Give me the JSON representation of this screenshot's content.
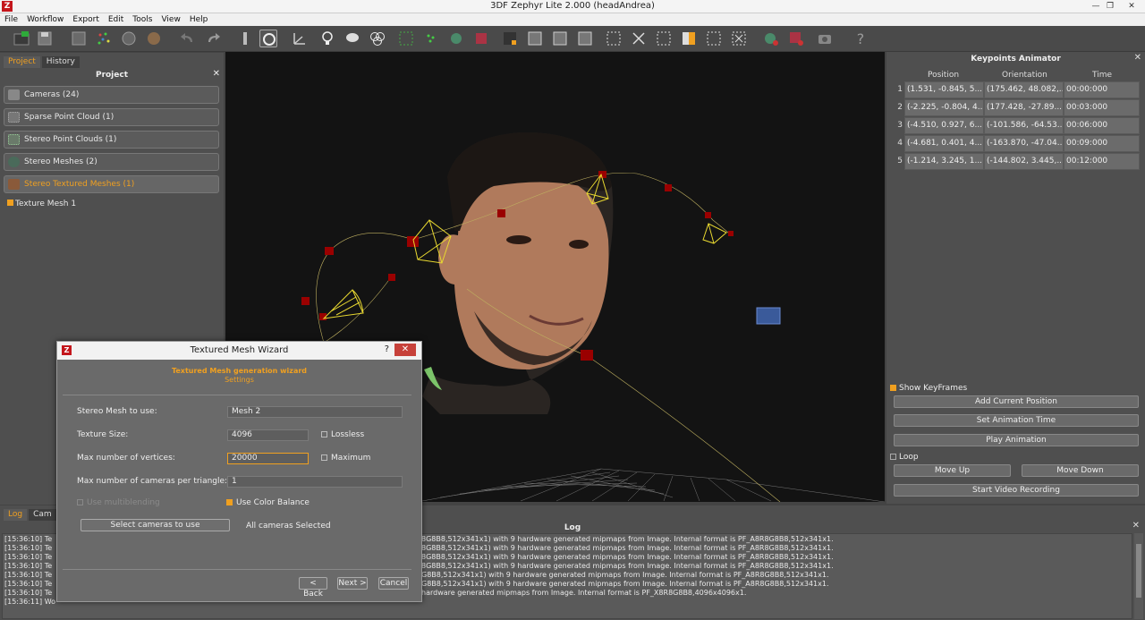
{
  "window": {
    "title": "3DF Zephyr Lite 2.000 (headAndrea)",
    "app_icon": "Z"
  },
  "menu": [
    "File",
    "Workflow",
    "Export",
    "Edit",
    "Tools",
    "View",
    "Help"
  ],
  "left_panel": {
    "tabs": [
      "Project",
      "History"
    ],
    "title": "Project",
    "items": [
      {
        "label": "Cameras (24)",
        "icon": "camera-icon"
      },
      {
        "label": "Sparse Point Cloud (1)",
        "icon": "sparse-cloud-icon"
      },
      {
        "label": "Stereo Point Clouds (1)",
        "icon": "dense-cloud-icon"
      },
      {
        "label": "Stereo Meshes (2)",
        "icon": "mesh-icon"
      },
      {
        "label": "Stereo Textured Meshes (1)",
        "icon": "textured-mesh-icon"
      }
    ],
    "subitem": "Texture Mesh 1"
  },
  "right_panel": {
    "title": "Keypoints Animator",
    "columns": [
      "Position",
      "Orientation",
      "Time"
    ],
    "rows": [
      {
        "n": "1",
        "position": "(1.531, -0.845, 5...",
        "orientation": "(175.462, 48.082,...",
        "time": "00:00:000"
      },
      {
        "n": "2",
        "position": "(-2.225, -0.804, 4...",
        "orientation": "(177.428, -27.89...",
        "time": "00:03:000"
      },
      {
        "n": "3",
        "position": "(-4.510, 0.927, 6...",
        "orientation": "(-101.586, -64.53...",
        "time": "00:06:000"
      },
      {
        "n": "4",
        "position": "(-4.681, 0.401, 4...",
        "orientation": "(-163.870, -47.04...",
        "time": "00:09:000"
      },
      {
        "n": "5",
        "position": "(-1.214, 3.245, 1...",
        "orientation": "(-144.802, 3.445,...",
        "time": "00:12:000"
      }
    ],
    "show_keyframes": "Show KeyFrames",
    "add_current_position": "Add Current Position",
    "set_animation_time": "Set Animation Time",
    "play_animation": "Play Animation",
    "loop": "Loop",
    "move_up": "Move Up",
    "move_down": "Move Down",
    "start_video_recording": "Start Video Recording"
  },
  "log": {
    "tabs": [
      "Log",
      "Cam"
    ],
    "title": "Log",
    "lines": [
      "[15:36:10] Te",
      "[15:36:10] Te",
      "[15:36:10] Te",
      "[15:36:10] Te",
      "[15:36:10] Te",
      "[15:36:10] Te",
      "[15:36:10] Te",
      "[15:36:11] Wo"
    ],
    "tails": [
      "8G8B8,512x341x1) with 9 hardware generated mipmaps from Image. Internal format is PF_A8R8G8B8,512x341x1.",
      "8G8B8,512x341x1) with 9 hardware generated mipmaps from Image. Internal format is PF_A8R8G8B8,512x341x1.",
      "8G8B8,512x341x1) with 9 hardware generated mipmaps from Image. Internal format is PF_A8R8G8B8,512x341x1.",
      "8G8B8,512x341x1) with 9 hardware generated mipmaps from Image. Internal format is PF_A8R8G8B8,512x341x1.",
      "G8B8,512x341x1) with 9 hardware generated mipmaps from Image. Internal format is PF_A8R8G8B8,512x341x1.",
      "G8B8,512x341x1) with 9 hardware generated mipmaps from Image. Internal format is PF_A8R8G8B8,512x341x1.",
      "hardware generated mipmaps from Image. Internal format is PF_X8R8G8B8,4096x4096x1."
    ]
  },
  "dialog": {
    "title": "Textured Mesh Wizard",
    "help": "?",
    "close": "✕",
    "heading": "Textured Mesh generation wizard",
    "subheading": "Settings",
    "stereo_mesh_label": "Stereo Mesh to use:",
    "stereo_mesh_value": "Mesh 2",
    "texture_size_label": "Texture Size:",
    "texture_size_value": "4096",
    "lossless": "Lossless",
    "max_vertices_label": "Max number of vertices:",
    "max_vertices_value": "20000",
    "maximum": "Maximum",
    "max_cameras_label": "Max number of cameras per triangle:",
    "max_cameras_value": "1",
    "use_multiblending": "Use multiblending",
    "use_color_balance": "Use Color Balance",
    "select_cameras": "Select cameras to use",
    "all_cameras": "All cameras Selected",
    "back": "< Back",
    "next": "Next >",
    "cancel": "Cancel"
  },
  "colors": {
    "accent": "#f0a020",
    "keyframe": "#8b0000",
    "camera_frustum": "#e8d830",
    "close_red": "#c7413a"
  }
}
